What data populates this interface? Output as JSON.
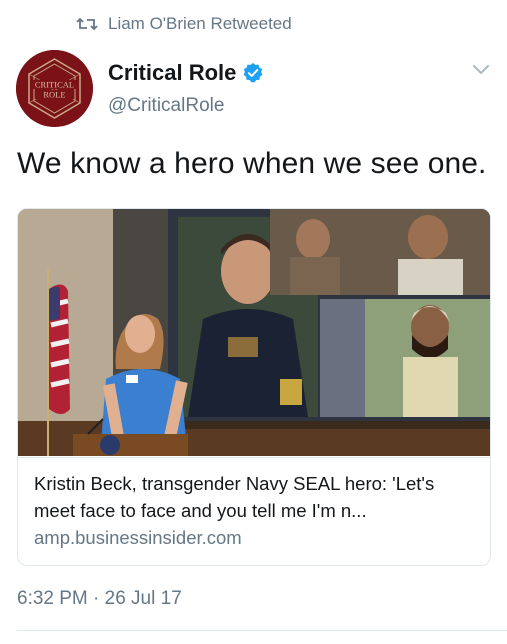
{
  "retweet": {
    "icon": "retweet-icon",
    "text": "Liam O'Brien Retweeted"
  },
  "author": {
    "display_name": "Critical Role",
    "handle": "@CriticalRole",
    "verified": true,
    "avatar_icon": "critical-role-logo",
    "avatar_text": "CRITICAL ROLE"
  },
  "tweet": {
    "text": "We know a hero when we see one."
  },
  "card": {
    "image": "photo-kristin-beck-speaking",
    "title": "Kristin Beck, transgender Navy SEAL hero: 'Let's meet face to face and you tell me I'm n...",
    "domain": "amp.businessinsider.com"
  },
  "meta": {
    "timestamp": "6:32 PM · 26 Jul 17"
  },
  "colors": {
    "secondary_text": "#657786",
    "primary_text": "#14171a",
    "verified_blue": "#1da1f2",
    "avatar_red": "#7a1218",
    "border": "#e1e8ed"
  }
}
